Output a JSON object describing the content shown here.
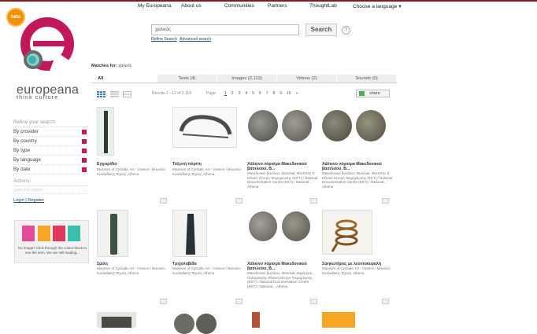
{
  "topnav": [
    "My Europeana",
    "About us",
    "Communities",
    "Partners",
    "ThoughtLab",
    "Choose a language"
  ],
  "brand": {
    "name": "europeana",
    "tagline": "think culture",
    "beta": "beta"
  },
  "search": {
    "query": "χαλκός",
    "button": "Search",
    "help": "?",
    "refine_link": "Refine Search",
    "advanced_link": "Advanced search"
  },
  "matches": {
    "label": "Matches for:",
    "query": "χαλκός"
  },
  "tabs": [
    "All",
    "Texts (4)",
    "Images (2,113)",
    "Videos (2)",
    "Sounds (0)"
  ],
  "toolbar": {
    "results": "Results 1 - 12 of 2,119",
    "page_label": "Page:",
    "pages": [
      "1",
      "2",
      "3",
      "4",
      "5",
      "6",
      "7",
      "8",
      "9",
      "10",
      "»"
    ],
    "share": "share"
  },
  "sidebar": {
    "heading": "Refine your search:",
    "facets": [
      "By provider",
      "By country",
      "By type",
      "By language",
      "By date"
    ],
    "actions_heading": "Actions:",
    "save": "Save this search",
    "login": "Login",
    "sep": " | ",
    "register": "Register"
  },
  "promo": "No image? Click through the colour block to see the item. We are still loading...",
  "results": [
    {
      "title": "Εγχειρίδιο",
      "desc": "Museum of Cycladic Art - Greece / Μουσείο Κυκλαδικής Τέχνης Athena"
    },
    {
      "title": "Τοξωτή πόρπη",
      "desc": "Museum of Cycladic Art - Greece / Μουσείο Κυκλαδικής Τέχνης Athena"
    },
    {
      "title": "Χάλκινο νόμισμα Μακεδονικού βασιλείου, Β...",
      "desc": "Μακεδονικό βασίλειο, Βασιλιάς Φίλιππος Ε΄ Εθνικό Κέντρο Τεκμηρίωσης (ΕΚΤ) / National Documentation Centre (EKT) / National... Athena"
    },
    {
      "title": "Χάλκινο νόμισμα Μακεδονικού βασιλείου, Β...",
      "desc": "Μακεδονικό βασίλειο, Βασιλιάς Φίλιππος Ε΄ Εθνικό Κέντρο Τεκμηρίωσης (ΕΚΤ) / National Documentation Centre (EKT) / National... Athena"
    },
    {
      "title": "Σμίλη",
      "desc": "Museum of Cycladic Art - Greece / Μουσείο Κυκλαδικής Τέχνης Athena"
    },
    {
      "title": "Τριχολαβίδα",
      "desc": "Museum of Cycladic Art - Greece / Μουσείο Κυκλαδικής Τέχνης Athena"
    },
    {
      "title": "Χάλκινο νόμισμα Μακεδονικού βασιλείου, Β...",
      "desc": "Μακεδονικό βασίλειο, Βασιλιάς Δημήτριος Πολιορκητής Εθνικό Κέντρο Τεκμηρίωσης (ΕΚΤ) / National Documentation Centre (EKT) / National... Athena"
    },
    {
      "title": "Σφηκωτήρας με λεοντοκεφαλή",
      "desc": "Museum of Cycladic Art - Greece / Μουσείο Κυκλαδικής Τέχνης Athena"
    }
  ],
  "colors": {
    "brand": "#c2185b",
    "beta": "#f29100",
    "topbar": "#7a1e1e"
  }
}
